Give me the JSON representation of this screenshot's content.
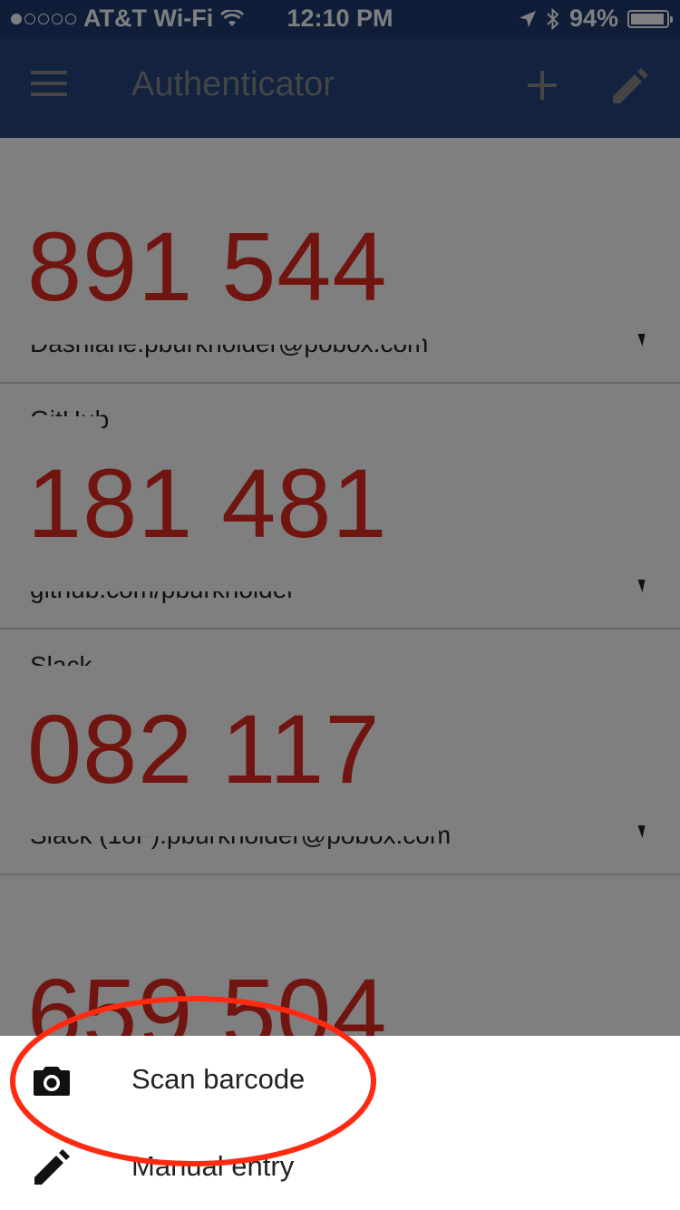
{
  "status_bar": {
    "carrier": "AT&T Wi-Fi",
    "time": "12:10 PM",
    "battery": "94%",
    "battery_level": 0.94,
    "signal_bars_filled": 1,
    "signal_bars_total": 5
  },
  "app_bar": {
    "title": "Authenticator",
    "menu_icon": "menu-icon",
    "add_icon": "add-icon",
    "edit_icon": "edit-icon"
  },
  "accounts": [
    {
      "issuer": "",
      "code": "891 544",
      "label": "Dashlane:pburkholder@pobox.com"
    },
    {
      "issuer": "GitHub",
      "code": "181 481",
      "label": "github.com/pburkholder"
    },
    {
      "issuer": "Slack",
      "code": "082 117",
      "label": "Slack (18F):pburkholder@pobox.com"
    },
    {
      "issuer": "",
      "code": "659 504",
      "label": ""
    }
  ],
  "bottom_sheet": {
    "scan": {
      "label": "Scan barcode",
      "icon": "camera-icon"
    },
    "manual": {
      "label": "Manual entry",
      "icon": "pencil-icon"
    }
  },
  "colors": {
    "status_bar": "#1e3a72",
    "app_bar": "#24447e",
    "code": "#e02b20",
    "annotation": "#ff2a12"
  }
}
